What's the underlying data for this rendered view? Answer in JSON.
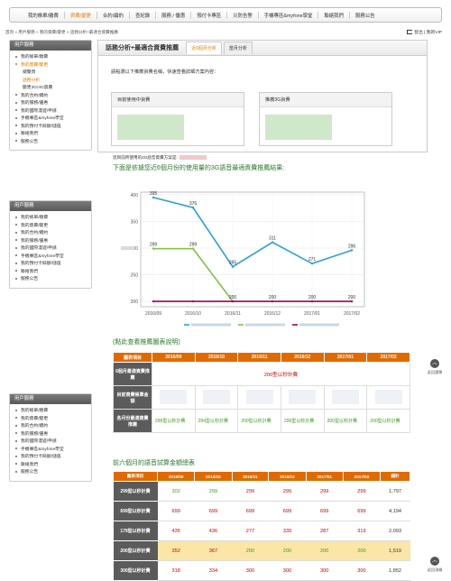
{
  "topnav": [
    "我的帳單/繳費",
    "資費/變更",
    "合約/續約",
    "查紀錄",
    "服務 / 優惠",
    "預付卡專區",
    "災防告警",
    "手機專區&myfone學堂",
    "聯絡我們",
    "服務公告"
  ],
  "breadcrumb": "首頁 » 用戶服務 » 我的資費/變更 » 話務分析+最適合資費推薦",
  "logout": "登出 | 我的VIP",
  "sidebar1": {
    "header": "用戶服務",
    "items": [
      "我的帳單/繳費",
      "我的資費/變更",
      "總覽頁",
      "話務分析",
      "變更3G/4G資費",
      "我的合約/續約",
      "我的服務/優惠",
      "我的國際漫遊/申請",
      "手機專區&myfone學堂",
      "我的預付卡餘額/儲值",
      "聯絡我們",
      "服務公告"
    ]
  },
  "sidebar2": {
    "header": "用戶服務",
    "items": [
      "我的帳單/繳費",
      "我的資費/變更",
      "我的合約/續約",
      "我的服務/優惠",
      "我的國際漫遊/申請",
      "手機專區&myfone學堂",
      "我的預付卡餘額/儲值",
      "聯絡我們",
      "服務公告"
    ]
  },
  "sidebar3": {
    "header": "用戶服務",
    "items": [
      "我的帳單/繳費",
      "我的資費/變更",
      "我的合約/續約",
      "我的服務/優惠",
      "我的國際漫遊/申請",
      "手機專區&myfone學堂",
      "我的預付卡餘額/儲值",
      "聯絡我們",
      "服務公告"
    ]
  },
  "main": {
    "title": "話務分析+最適合資費推薦",
    "tabs": [
      "近6個月分析",
      "當月分析"
    ],
    "prompt": "請點選以下推薦資費名稱，快速查看詳細方案內容：",
    "card_current": "目前使用中資費",
    "card_recommend": "推薦3G資費",
    "note": "您目前所使用的3G語音資費方案是:",
    "chart_title": "下面是依據您近6個月份的使用量的3G語音最適資費推薦結果:",
    "hint": "(點此查看推薦圖表說明)"
  },
  "chart_data": {
    "type": "line",
    "categories": [
      "2016/09",
      "2016/10",
      "2016/11",
      "2016/12",
      "2017/01",
      "2017/02"
    ],
    "ylim": [
      190,
      405
    ],
    "yticks": [
      200,
      250,
      300,
      350,
      400
    ],
    "series": [
      {
        "color": "#2a9fd6",
        "values": [
          395,
          376,
          265,
          311,
          271,
          296
        ],
        "labels": [
          "395",
          "376",
          "265",
          "311",
          "271",
          "296"
        ]
      },
      {
        "color": "#7ec242",
        "values": [
          299,
          299,
          200,
          null,
          null,
          null
        ],
        "labels": [
          "299",
          "299",
          "",
          "",
          "",
          ""
        ]
      },
      {
        "color": "#a0005a",
        "values": [
          200,
          200,
          200,
          200,
          200,
          200
        ],
        "labels": [
          "",
          "",
          "200",
          "200",
          "200",
          "200"
        ]
      }
    ]
  },
  "table1": {
    "headers": [
      "圖表項目",
      "2016/09",
      "2016/10",
      "2016/11",
      "2016/12",
      "2017/01",
      "2017/02"
    ],
    "row1_label": "6個月最適資費推薦",
    "row1_value": "200型以秒計費",
    "row2_label": "目前資費帳單金額",
    "row3_label": "各月份最適資費推薦",
    "row3_values": [
      "299型以秒計費",
      "299型以秒計費",
      "200型以秒計費",
      "200型以秒計費",
      "200型以秒計費",
      "200型以秒計費"
    ]
  },
  "table2": {
    "title": "前六個月的語音試算金額總表",
    "headers": [
      "圖表項目",
      "2016/09",
      "2016/10",
      "2016/11",
      "2016/12",
      "2017/01",
      "2017/02",
      "總計"
    ],
    "rows": [
      {
        "label": "299型以秒計費",
        "values": [
          "302",
          "299",
          "299",
          "299",
          "299",
          "299"
        ],
        "total": "1,797",
        "green": [
          0,
          1
        ]
      },
      {
        "label": "699型以秒計費",
        "values": [
          "699",
          "699",
          "699",
          "699",
          "699",
          "699"
        ],
        "total": "4,194",
        "green": []
      },
      {
        "label": "179型以秒計費",
        "values": [
          "435",
          "436",
          "277",
          "339",
          "287",
          "319"
        ],
        "total": "2,093",
        "green": []
      },
      {
        "label": "200型以秒計費",
        "values": [
          "352",
          "367",
          "200",
          "200",
          "200",
          "200"
        ],
        "total": "1,519",
        "green": [
          2,
          3,
          4,
          5
        ]
      },
      {
        "label": "300型以秒計費",
        "values": [
          "318",
          "334",
          "300",
          "300",
          "300",
          "300"
        ],
        "total": "1,852",
        "green": []
      }
    ]
  },
  "back_to_top": "返回頂端",
  "back_to_menu": "返回選單"
}
